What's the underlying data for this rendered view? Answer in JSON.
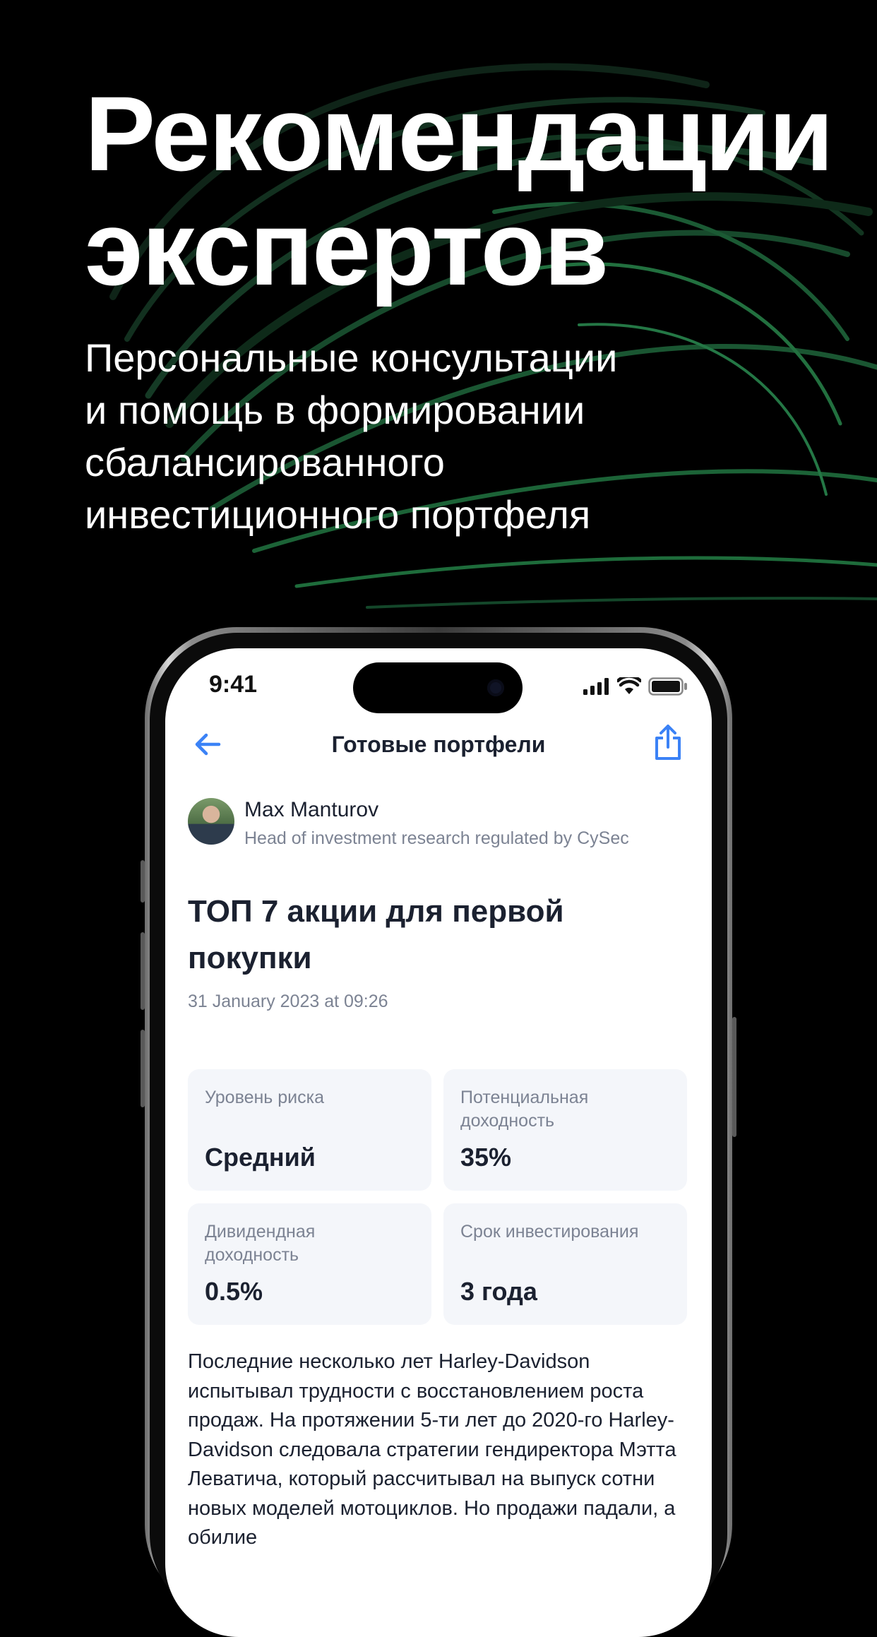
{
  "promo": {
    "headline_line1": "Рекомендации",
    "headline_line2": "экспертов",
    "subtitle_line1": "Персональные консультации",
    "subtitle_line2": "и помощь в формировании",
    "subtitle_line3": "сбалансированного",
    "subtitle_line4": "инвестиционного портфеля"
  },
  "status_bar": {
    "time": "9:41"
  },
  "nav": {
    "back_icon": "arrow-left-icon",
    "title": "Готовые портфели",
    "share_icon": "share-icon"
  },
  "author": {
    "name": "Max Manturov",
    "role": "Head of investment research regulated by CySec"
  },
  "post": {
    "title": "ТОП 7 акции для первой покупки",
    "date": "31 January 2023 at 09:26"
  },
  "metrics": [
    {
      "label": "Уровень риска",
      "value": "Средний"
    },
    {
      "label": "Потенциальная доходность",
      "value": "35%"
    },
    {
      "label": "Дивидендная доходность",
      "value": "0.5%"
    },
    {
      "label": "Срок инвестирования",
      "value": "3 года"
    }
  ],
  "body": {
    "text": "Последние несколько лет Harley-Davidson испытывал трудности с восстановлением роста продаж. На протяжении 5-ти лет до 2020-го Harley-Davidson следовала стратегии гендиректора Мэтта Леватича, который рассчитывал на выпуск сотни новых моделей мотоциклов. Но продажи падали, а обилие"
  },
  "colors": {
    "accent": "#3b82f6",
    "background": "#000000",
    "card_bg": "#f4f6fa",
    "text_primary": "#1b2130",
    "text_secondary": "#7c8393"
  }
}
